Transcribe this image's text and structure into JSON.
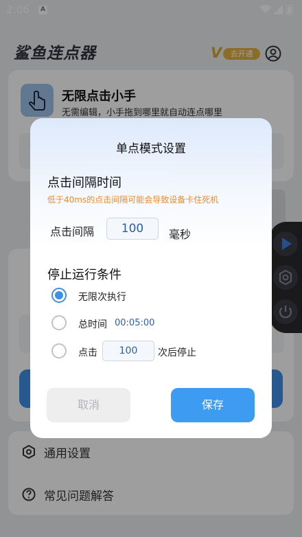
{
  "status_bar": {
    "time": "2:06",
    "app_indicator": "A",
    "icons": [
      "wifi-icon",
      "signal-icon",
      "battery-icon"
    ]
  },
  "header": {
    "app_title": "鲨鱼连点器",
    "vip_letter": "V",
    "vip_label": "去开通",
    "profile_icon": "profile-icon"
  },
  "card_single": {
    "title": "无限点击小手",
    "subtitle": "无需编辑，小手拖到哪里就自动连点哪里",
    "icon": "hand-tap-icon"
  },
  "menu": [
    {
      "label": "通用设置",
      "icon": "hexagon-settings-icon"
    },
    {
      "label": "常见问题解答",
      "icon": "question-circle-icon"
    }
  ],
  "float_panel": {
    "icons": [
      "play-icon",
      "gear-icon",
      "power-icon"
    ]
  },
  "dialog": {
    "title": "单点模式设置",
    "interval_section": {
      "title": "点击间隔时间",
      "warning": "低于40ms的点击间隔可能会导致设备卡住死机",
      "label": "点击间隔",
      "value": "100",
      "unit": "毫秒"
    },
    "stop_section": {
      "title": "停止运行条件",
      "options": [
        {
          "label": "无限次执行",
          "selected": true
        },
        {
          "label": "总时间",
          "value": "00:05:00",
          "selected": false
        },
        {
          "label": "点击",
          "value": "100",
          "suffix": "次后停止",
          "selected": false
        }
      ]
    },
    "cancel_label": "取消",
    "save_label": "保存"
  },
  "colors": {
    "accent": "#3d9cf2",
    "warning": "#f08a2a",
    "vip": "#e0b140"
  }
}
